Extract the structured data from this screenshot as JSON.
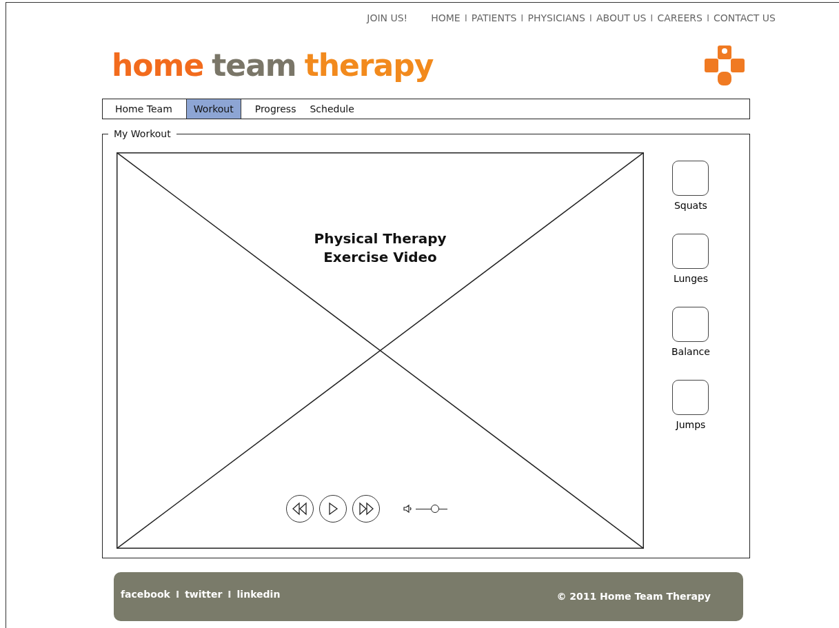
{
  "top_nav": {
    "join": "JOIN US!",
    "items": [
      {
        "kind": "link",
        "text": "HOME"
      },
      {
        "kind": "separator",
        "text": "I"
      },
      {
        "kind": "link",
        "text": "PATIENTS"
      },
      {
        "kind": "separator",
        "text": "I"
      },
      {
        "kind": "link",
        "text": "PHYSICIANS"
      },
      {
        "kind": "separator",
        "text": "I"
      },
      {
        "kind": "link",
        "text": "ABOUT US"
      },
      {
        "kind": "separator",
        "text": "I"
      },
      {
        "kind": "link",
        "text": "CAREERS"
      },
      {
        "kind": "separator",
        "text": "I"
      },
      {
        "kind": "link",
        "text": "CONTACT US"
      }
    ]
  },
  "logo": {
    "words": [
      {
        "text": "home",
        "color": "#f26b1d"
      },
      {
        "text": "team",
        "color": "#7a7668"
      },
      {
        "text": "therapy",
        "color": "#f28a1d"
      }
    ]
  },
  "tabs": [
    {
      "label": "Home Team",
      "selected": false
    },
    {
      "label": "Workout",
      "selected": true
    },
    {
      "label": "Progress",
      "selected": false
    },
    {
      "label": "Schedule",
      "selected": false
    }
  ],
  "section": {
    "title": "My Workout",
    "video": {
      "title_lines": [
        "Physical Therapy",
        "Exercise Video"
      ],
      "volume": {
        "level": 0.6
      }
    },
    "exercises": [
      {
        "label": "Squats"
      },
      {
        "label": "Lunges"
      },
      {
        "label": "Balance"
      },
      {
        "label": "Jumps"
      }
    ]
  },
  "footer": {
    "items": [
      {
        "kind": "link",
        "text": "facebook"
      },
      {
        "kind": "separator",
        "text": "I"
      },
      {
        "kind": "link",
        "text": "twitter"
      },
      {
        "kind": "separator",
        "text": "I"
      },
      {
        "kind": "link",
        "text": "linkedin"
      }
    ],
    "copyright": "© 2011 Home Team Therapy"
  }
}
